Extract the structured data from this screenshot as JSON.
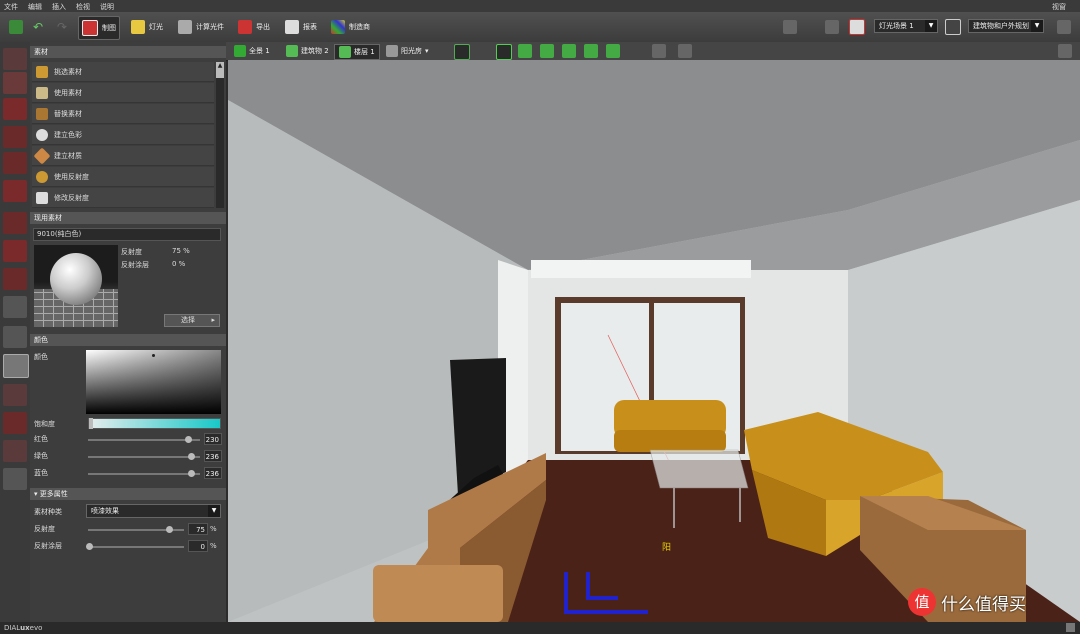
{
  "menu": [
    "文件",
    "编辑",
    "插入",
    "检视",
    "说明"
  ],
  "menu_right": "视窗",
  "ribbon": {
    "draw_label": "制图",
    "light_label": "灯光",
    "calc_label": "计算光件",
    "export_label": "导出",
    "report_label": "报表",
    "manufacturer_label": "制造商",
    "light_scene_label": "灯光场景 1",
    "view_mode_label": "建筑物和户外规划"
  },
  "view_tabs": {
    "scene": "全景 1",
    "building": "建筑物 2",
    "floor": "楼层 1",
    "sunroom": "阳光房"
  },
  "panel": {
    "materials_header": "素材",
    "items": [
      "挑选素材",
      "使用素材",
      "替换素材",
      "建立色彩",
      "建立材质",
      "使用反射度",
      "修改反射度"
    ],
    "current_header": "现用素材",
    "current_name": "9010(纯白色)",
    "reflectance_label": "反射度",
    "reflectance_value": "75 %",
    "coating_label": "反射涂层",
    "coating_value": "0 %",
    "select_button": "选择",
    "color_header": "颜色",
    "color_label": "颜色",
    "saturation_label": "饱和度",
    "red_label": "红色",
    "red_value": "230",
    "green_label": "绿色",
    "green_value": "236",
    "blue_label": "蓝色",
    "blue_value": "236",
    "more_header": "更多属性",
    "material_type_label": "素材种类",
    "material_type_value": "喷漆效果",
    "reflect2_label": "反射度",
    "reflect2_value": "75",
    "coat2_label": "反射涂层",
    "coat2_value": "0",
    "percent": "%"
  },
  "status": {
    "app_name_a": "DIAL",
    "app_name_b": "ux",
    "app_name_c": "evo"
  },
  "watermark": {
    "badge": "值",
    "text": "什么值得买"
  },
  "scene_label": "阳"
}
